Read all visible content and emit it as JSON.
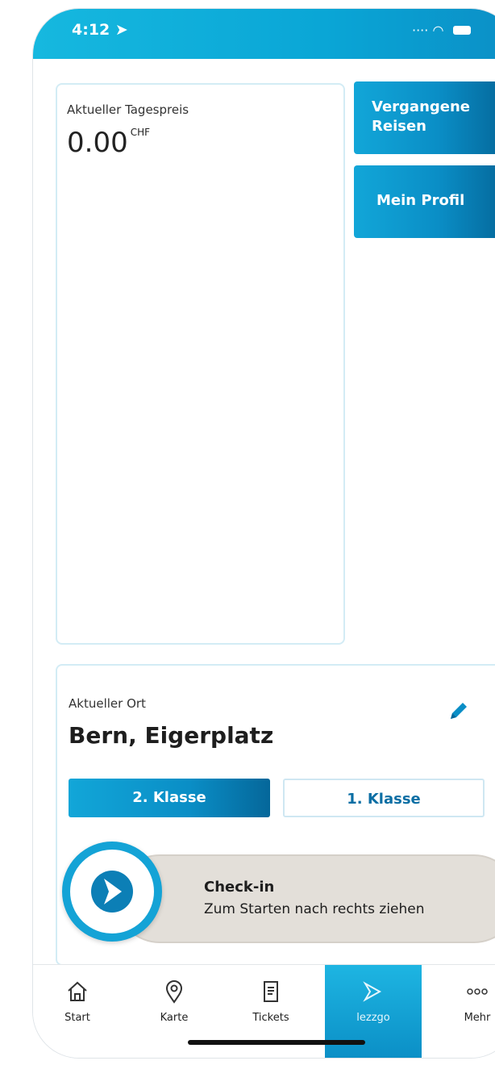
{
  "status_bar": {
    "time": "4:12"
  },
  "price_card": {
    "label": "Aktueller Tagespreis",
    "value": "0.00",
    "unit": "CHF"
  },
  "buttons": {
    "past_trips": "Vergangene Reisen",
    "profile": "Mein Profil"
  },
  "location": {
    "label": "Aktueller Ort",
    "name": "Bern, Eigerplatz"
  },
  "classes": {
    "second": "2. Klasse",
    "first": "1. Klasse",
    "selected": "2. Klasse"
  },
  "checkin": {
    "title": "Check-in",
    "subtitle": "Zum Starten nach rechts ziehen"
  },
  "tabbar": {
    "items": [
      {
        "label": "Start",
        "icon": "home-icon"
      },
      {
        "label": "Karte",
        "icon": "map-pin-icon"
      },
      {
        "label": "Tickets",
        "icon": "ticket-icon"
      },
      {
        "label": "lezzgo",
        "icon": "lezzgo-icon"
      },
      {
        "label": "Mehr",
        "icon": "more-dots-icon"
      }
    ],
    "active": "lezzgo"
  },
  "colors": {
    "accent": "#0a8ec6",
    "accent_dark": "#05679a",
    "track": "#e3dfd9"
  }
}
